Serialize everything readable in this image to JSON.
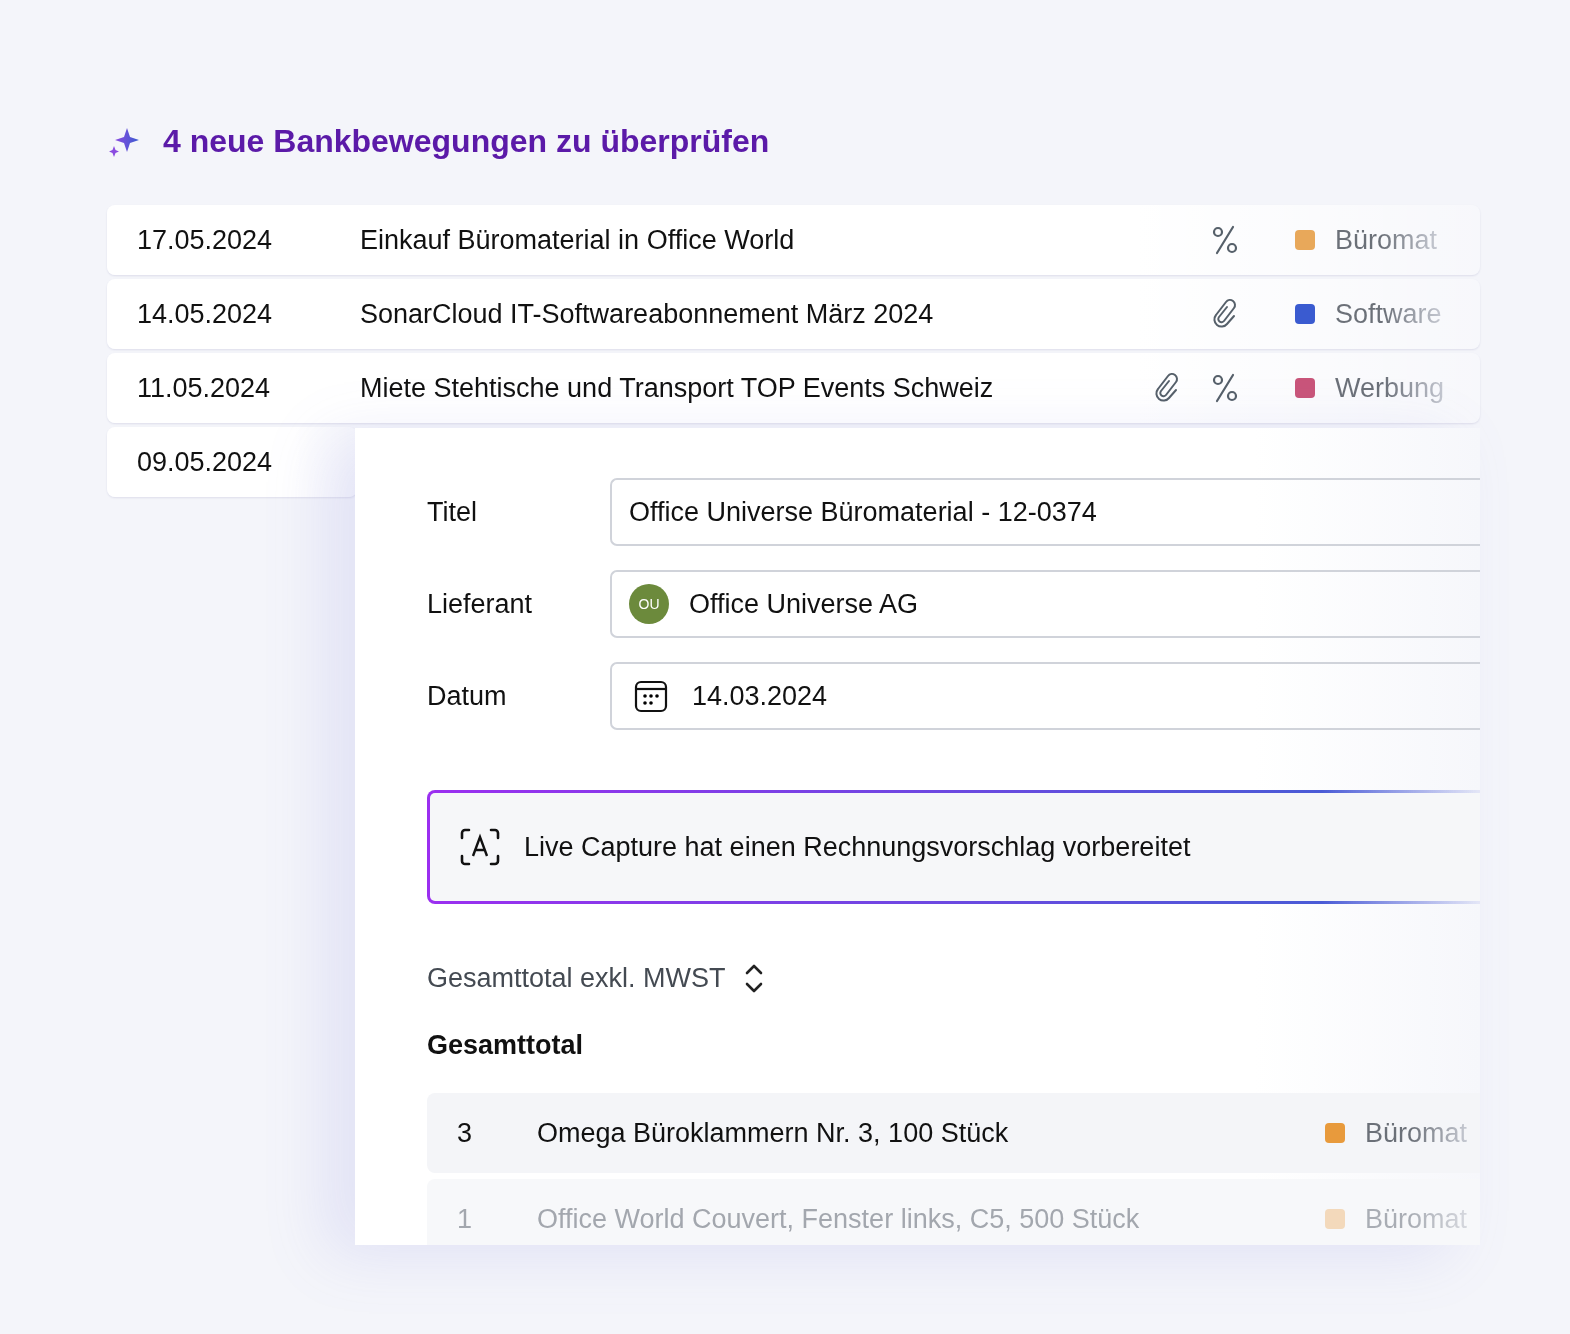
{
  "header": {
    "title": "4 neue Bankbewegungen zu überprüfen"
  },
  "transactions": [
    {
      "date": "17.05.2024",
      "description": "Einkauf Büromaterial in Office World",
      "attachment": false,
      "vat": true,
      "category": "Büromat",
      "color": "#e8a85a"
    },
    {
      "date": "14.05.2024",
      "description": "SonarCloud IT-Softwareabonnement März 2024",
      "attachment": true,
      "vat": false,
      "category": "Software",
      "color": "#3a5bd0"
    },
    {
      "date": "11.05.2024",
      "description": "Miete Stehtische und Transport TOP Events Schweiz",
      "attachment": true,
      "vat": true,
      "category": "Werbung",
      "color": "#c9557a"
    },
    {
      "date": "09.05.2024"
    }
  ],
  "panel": {
    "fields": [
      {
        "kind": "text",
        "label": "Titel",
        "value": "Office Universe Büromaterial - 12-0374"
      },
      {
        "kind": "supplier",
        "label": "Lieferant",
        "avatar": "OU",
        "value": "Office Universe AG"
      },
      {
        "kind": "date",
        "label": "Datum",
        "value": "14.03.2024"
      }
    ],
    "capture": {
      "text": "Live Capture hat einen Rechnungsvorschlag vorbereitet"
    },
    "total_selector": {
      "label": "Gesamttotal exkl. MWST"
    },
    "total_heading": "Gesamttotal",
    "items": [
      {
        "qty": "3",
        "description": "Omega Büroklammern Nr. 3, 100 Stück",
        "category": "Büromat",
        "color": "#e89a3c",
        "muted": false
      },
      {
        "qty": "1",
        "description": "Office World Couvert, Fenster links, C5, 500 Stück",
        "category": "Büromat",
        "color": "#f3d9bb",
        "muted": true
      }
    ]
  }
}
